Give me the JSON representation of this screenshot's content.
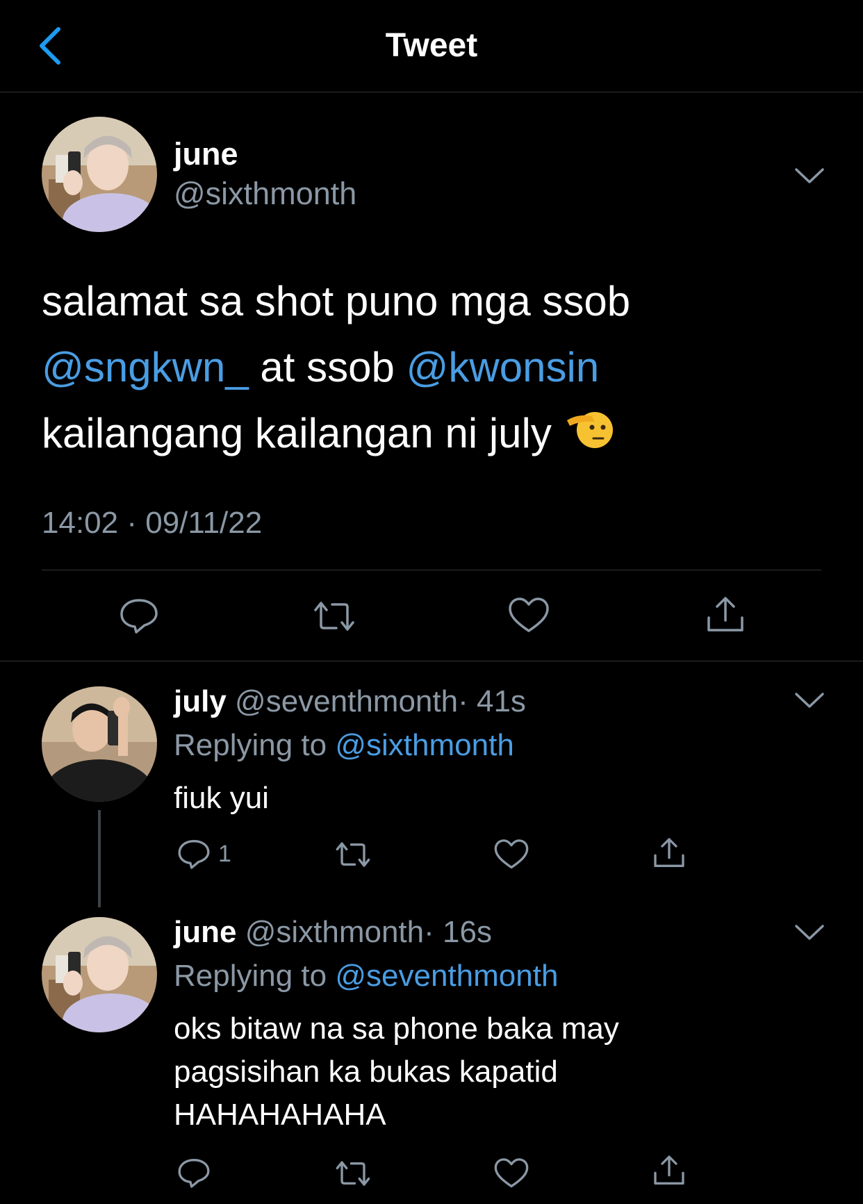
{
  "header": {
    "title": "Tweet",
    "back_icon": "chevron-left-icon",
    "accent": "#1d9bf0"
  },
  "main_tweet": {
    "name": "june",
    "handle": "@sixthmonth",
    "text_line1": "salamat sa shot puno mga ssob",
    "mention1": "@sngkwn_",
    "text_mid": " at ssob ",
    "mention2": "@kwonsin",
    "text_line3": "kailangang kailangan ni july",
    "emoji": "saluting-face-emoji",
    "time": "14:02",
    "separator": " · ",
    "date": "09/11/22",
    "actions": [
      "reply-icon",
      "retweet-icon",
      "like-icon",
      "share-icon"
    ]
  },
  "replies": [
    {
      "name": "july",
      "handle": "@seventhmonth",
      "age": "· 41s",
      "replying_label": "Replying to ",
      "replying_to": "@sixthmonth",
      "lines": [
        "fiuk yui"
      ],
      "reply_count": "1"
    },
    {
      "name": "june",
      "handle": "@sixthmonth",
      "age": "· 16s",
      "replying_label": "Replying to ",
      "replying_to": "@seventhmonth",
      "lines": [
        "oks bitaw na sa phone baka may",
        "pagsisihan ka bukas kapatid",
        "HAHAHAHAHA"
      ],
      "reply_count": ""
    }
  ],
  "colors": {
    "background": "#000000",
    "secondary_text": "#8b98a5",
    "mention": "#4a9de3",
    "divider": "#2f3336"
  }
}
